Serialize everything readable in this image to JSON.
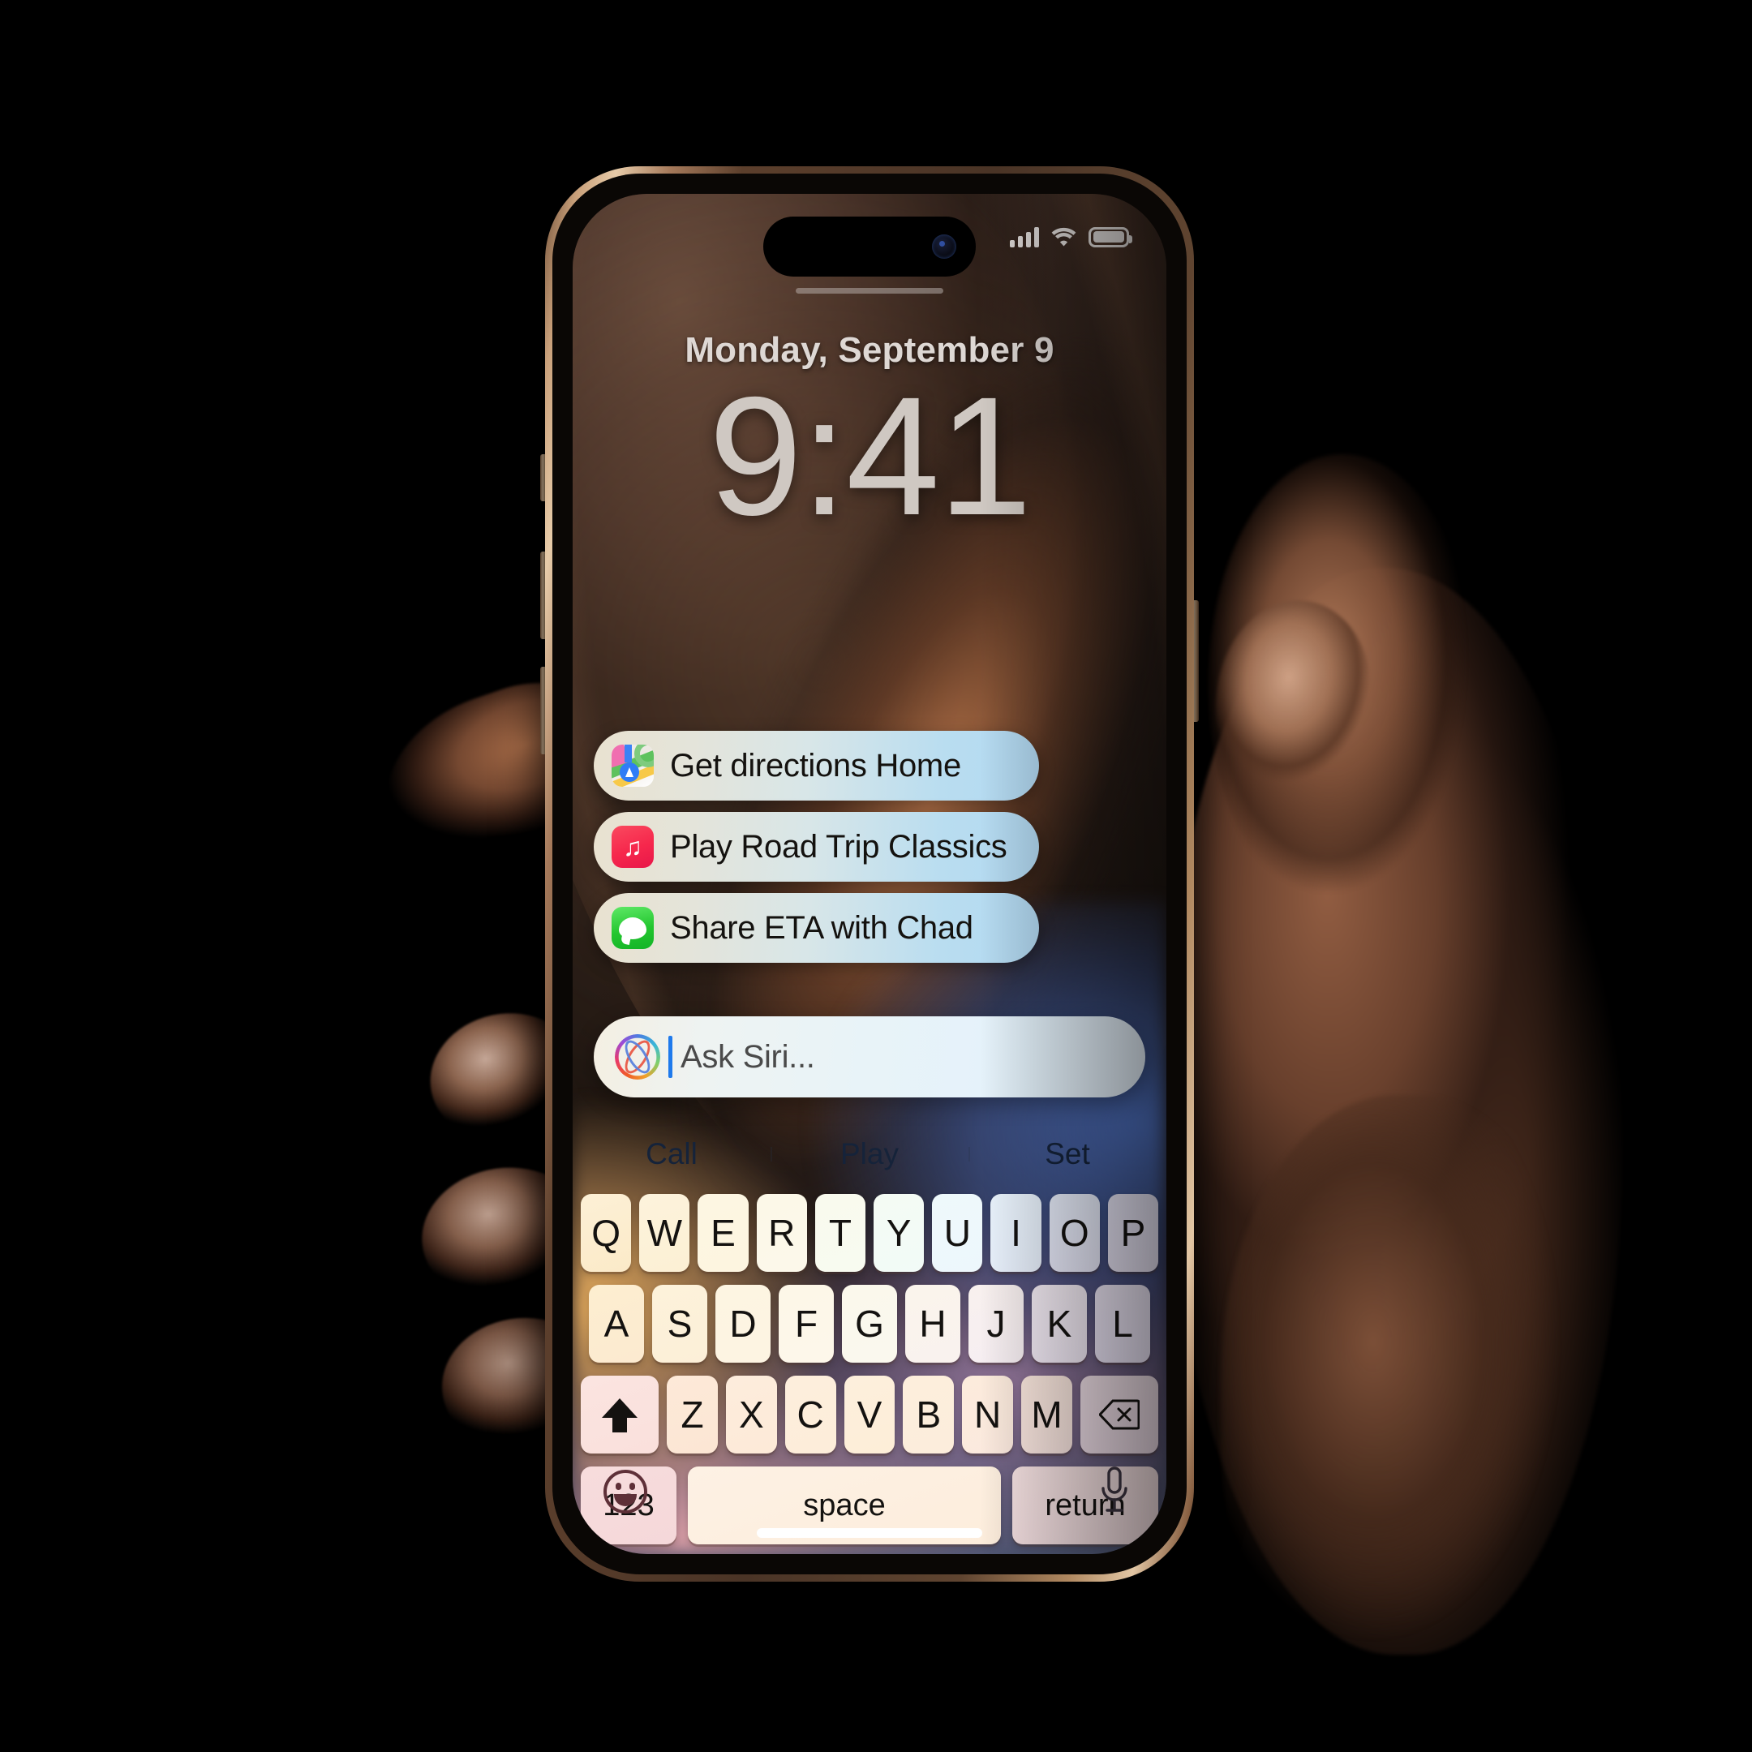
{
  "scene": {
    "background_color": "#000000",
    "device": "iPhone",
    "device_frame_color": "#d9b68f"
  },
  "status_bar": {
    "signal_icon": "cellular-signal-icon",
    "signal_bars": 4,
    "wifi_icon": "wifi-icon",
    "battery_icon": "battery-icon",
    "battery_level_percent": 88
  },
  "lock_screen": {
    "date": "Monday, September 9",
    "time": "9:41"
  },
  "siri": {
    "suggestions": [
      {
        "label": "Get directions Home",
        "icon": "maps-app-icon",
        "app": "Maps"
      },
      {
        "label": "Play Road Trip Classics",
        "icon": "music-app-icon",
        "app": "Music"
      },
      {
        "label": "Share ETA with Chad",
        "icon": "messages-app-icon",
        "app": "Messages"
      }
    ],
    "input": {
      "placeholder": "Ask Siri...",
      "value": "",
      "icon": "siri-loop-icon",
      "cursor_color": "#1f7aec"
    }
  },
  "predictive_bar": {
    "suggestions": [
      "Call",
      "Play",
      "Set"
    ]
  },
  "keyboard": {
    "row1": [
      "Q",
      "W",
      "E",
      "R",
      "T",
      "Y",
      "U",
      "I",
      "O",
      "P"
    ],
    "row2": [
      "A",
      "S",
      "D",
      "F",
      "G",
      "H",
      "J",
      "K",
      "L"
    ],
    "row3_letters": [
      "Z",
      "X",
      "C",
      "V",
      "B",
      "N",
      "M"
    ],
    "shift_icon": "shift-icon",
    "delete_icon": "backspace-icon",
    "numbers_key": "123",
    "space_key": "space",
    "return_key": "return",
    "emoji_icon": "emoji-icon",
    "dictation_icon": "microphone-icon"
  },
  "home_indicator": {
    "visible": true
  }
}
